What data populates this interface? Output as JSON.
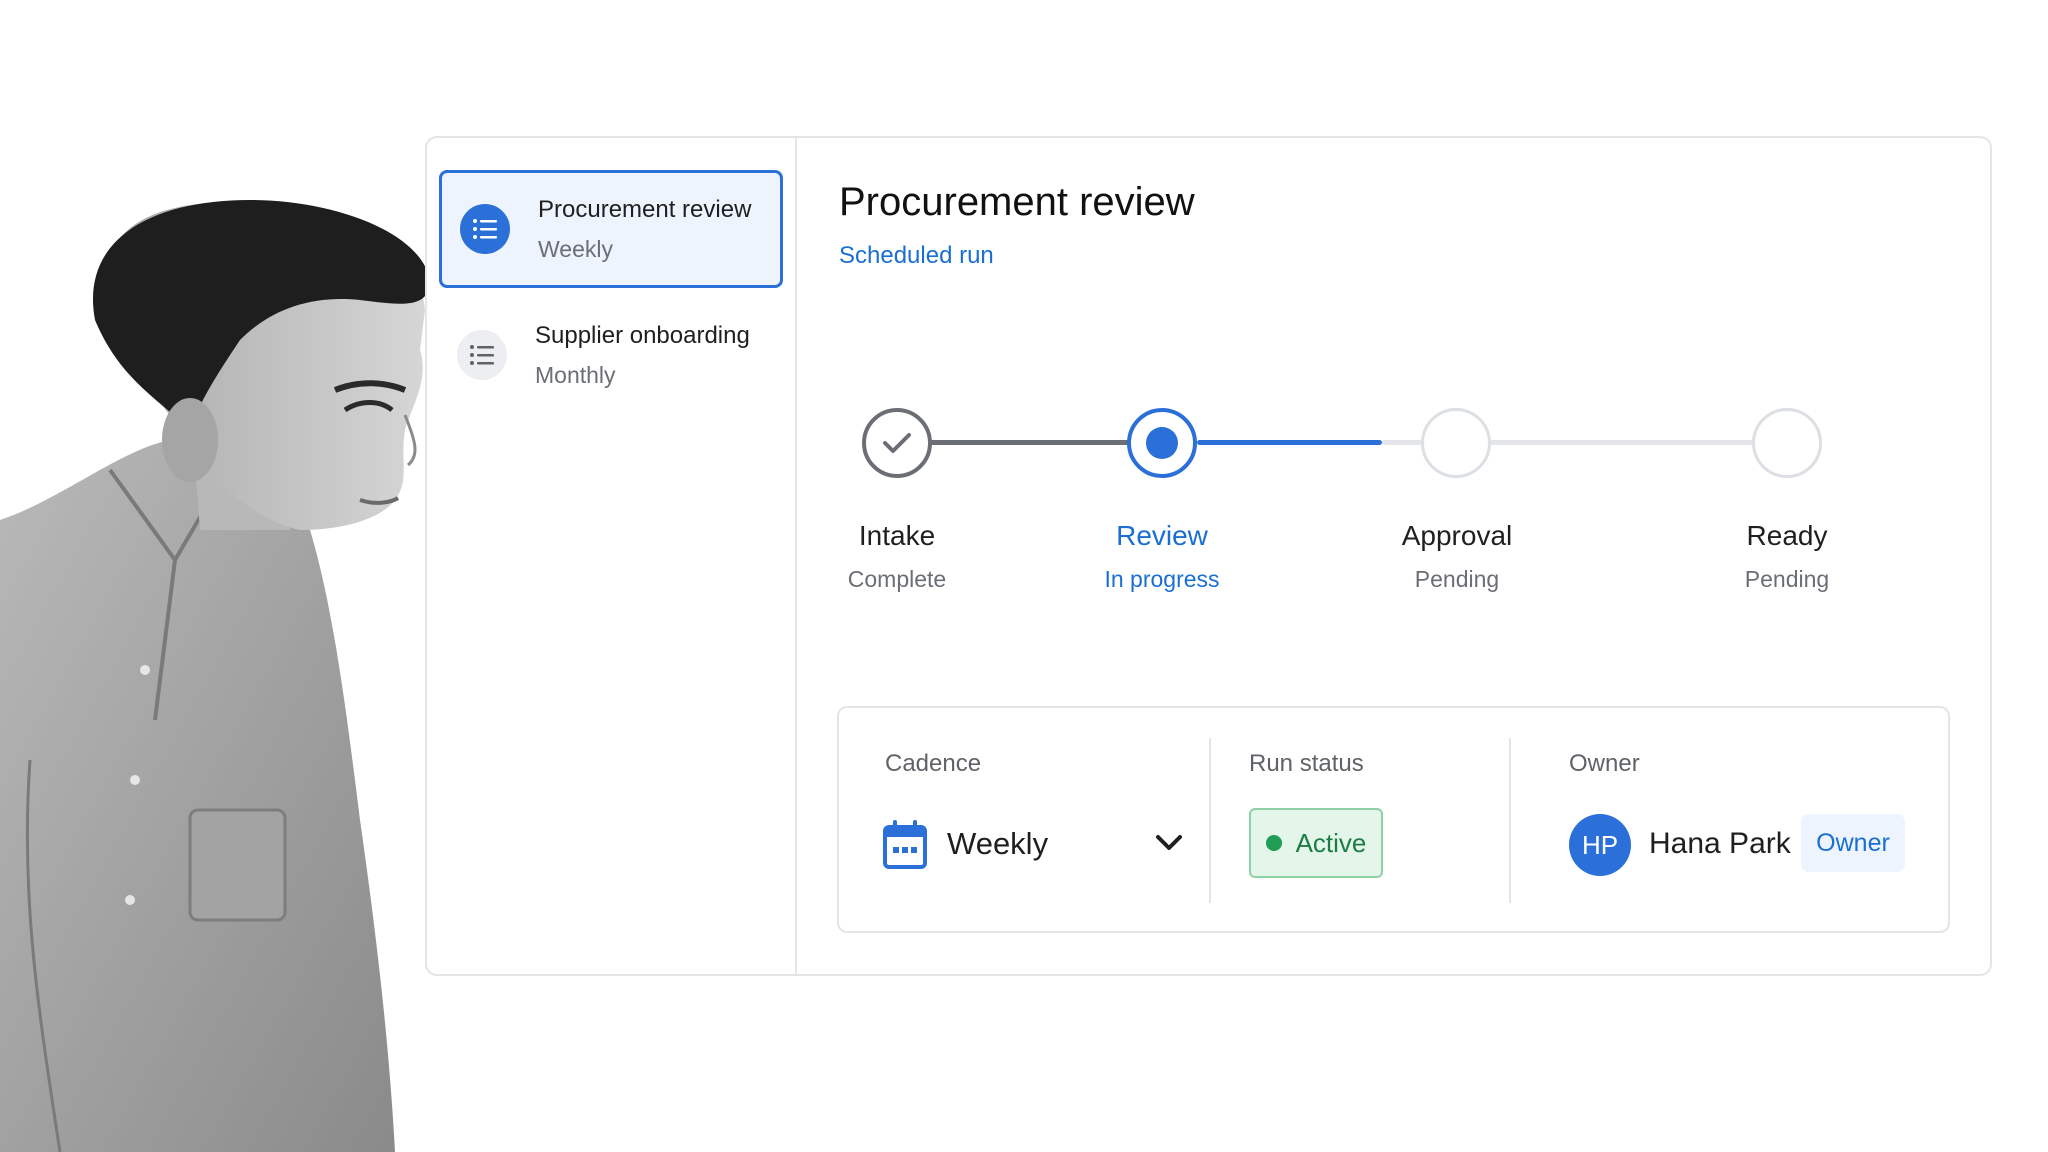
{
  "sidebar": {
    "items": [
      {
        "title": "Procurement review",
        "subtitle": "Weekly",
        "icon": "list-icon",
        "active": true
      },
      {
        "title": "Supplier onboarding",
        "subtitle": "Monthly",
        "icon": "list-icon",
        "active": false
      }
    ]
  },
  "header": {
    "title": "Procurement review",
    "subtitle": "Scheduled run"
  },
  "stepper": {
    "steps": [
      {
        "label": "Intake",
        "status": "Complete",
        "state": "done"
      },
      {
        "label": "Review",
        "status": "In progress",
        "state": "current"
      },
      {
        "label": "Approval",
        "status": "Pending",
        "state": "pending"
      },
      {
        "label": "Ready",
        "status": "Pending",
        "state": "pending"
      }
    ]
  },
  "details": {
    "cadence": {
      "label": "Cadence",
      "value": "Weekly",
      "icon": "calendar-icon"
    },
    "run_status": {
      "label": "Run status",
      "value": "Active"
    },
    "owner": {
      "label": "Owner",
      "initials": "HP",
      "name": "Hana Park",
      "role": "Owner"
    }
  },
  "colors": {
    "accent": "#2b6fd8",
    "link": "#1a6fd1",
    "success": "#1f9d55",
    "success_bg": "#e4f5ea",
    "border": "#e3e5e8",
    "muted_text": "#6b6f75"
  }
}
